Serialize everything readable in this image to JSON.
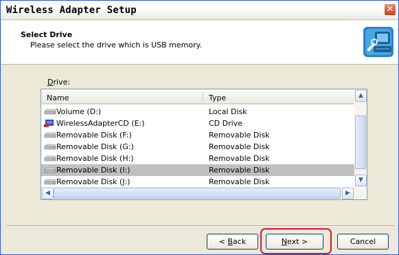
{
  "window": {
    "title": "Wireless Adapter Setup",
    "close_glyph": "✕"
  },
  "header": {
    "title": "Select Drive",
    "subtitle": "Please select the drive which is USB memory.",
    "icon": "computer-setup-icon"
  },
  "drive_list": {
    "label_prefix": "D",
    "label_rest": "rive:",
    "columns": {
      "name": "Name",
      "type": "Type"
    },
    "rows": [
      {
        "name": "Volume (D:)",
        "type": "Local Disk",
        "icon": "drive-icon",
        "selected": false
      },
      {
        "name": "WirelessAdapterCD (E:)",
        "type": "CD Drive",
        "icon": "cd-drive-icon",
        "selected": false
      },
      {
        "name": "Removable Disk (F:)",
        "type": "Removable Disk",
        "icon": "drive-icon",
        "selected": false
      },
      {
        "name": "Removable Disk (G:)",
        "type": "Removable Disk",
        "icon": "drive-icon",
        "selected": false
      },
      {
        "name": "Removable Disk (H:)",
        "type": "Removable Disk",
        "icon": "drive-icon",
        "selected": false
      },
      {
        "name": "Removable Disk (I:)",
        "type": "Removable Disk",
        "icon": "drive-icon",
        "selected": true
      },
      {
        "name": "Removable Disk (J:)",
        "type": "Removable Disk",
        "icon": "drive-icon",
        "selected": false
      }
    ],
    "scroll_up": "▲",
    "scroll_down": "▼",
    "scroll_left": "◀",
    "scroll_right": "▶"
  },
  "buttons": {
    "back_prefix": "< ",
    "back_key": "B",
    "back_rest": "ack",
    "next_key": "N",
    "next_rest": "ext >",
    "cancel": "Cancel"
  },
  "colors": {
    "title_bar_border": "#2d5bd0",
    "highlight": "#e0102a",
    "selected_row": "#c0c0c0"
  }
}
